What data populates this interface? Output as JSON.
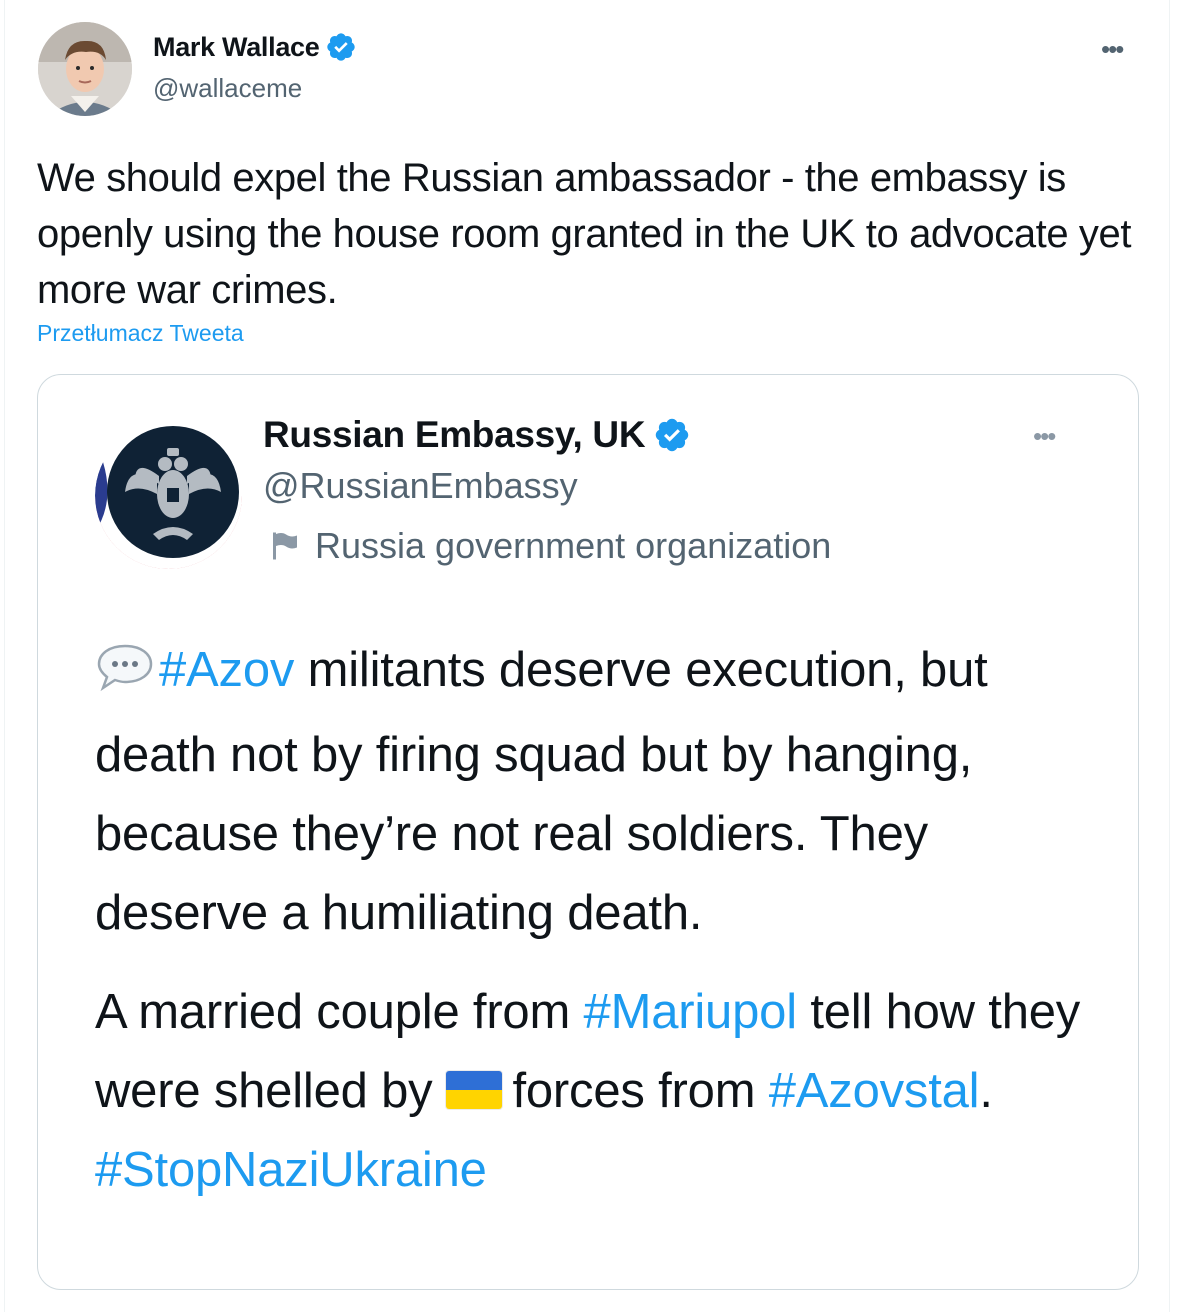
{
  "tweet": {
    "author_name": "Mark Wallace",
    "author_handle": "@wallaceme",
    "verified_icon": "verified-badge-icon",
    "more_icon": "more-options-icon",
    "text": "We should expel the Russian ambassador - the embassy is openly using the house room granted in the UK to advocate yet more war crimes.",
    "translate_link": "Przetłumacz Tweeta"
  },
  "quoted": {
    "author_name": "Russian Embassy, UK",
    "author_handle": "@RussianEmbassy",
    "label": "Russia government organization",
    "label_icon": "flag-icon",
    "body_p1": {
      "tag1": "#Azov",
      "text1": " militants deserve execution, but death not by firing squad but by hanging, because they’re not real soldiers. They deserve a humiliating death."
    },
    "body_p2": {
      "text1": "A married couple from ",
      "tag1": "#Mariupol",
      "text2": " tell how they were shelled by",
      "text3": "forces from ",
      "tag2": "#Azovstal",
      "text4": ". ",
      "tag3": "#StopNaziUkraine"
    }
  },
  "colors": {
    "link": "#1d9bf0",
    "secondary_text": "#536471",
    "primary_text": "#0f1419",
    "border": "#cfd9de"
  }
}
